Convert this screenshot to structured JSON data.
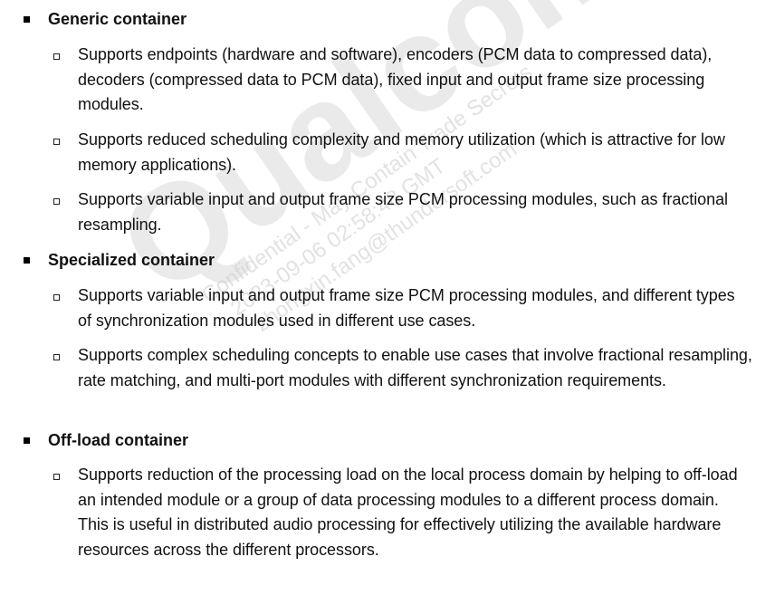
{
  "watermark": {
    "brand": "Qualcomm",
    "lines": [
      "Confidential - May Contain Trade Secrets",
      "2023-09-06 02:58:48 GMT",
      "zhongxin.fang@thundersoft.com"
    ]
  },
  "sections": [
    {
      "heading": "Generic container",
      "items": [
        "Supports endpoints (hardware and software), encoders (PCM data to compressed data), decoders (compressed data to PCM data), fixed input and output frame size processing modules.",
        "Supports reduced scheduling complexity and memory utilization (which is attractive for low memory applications).",
        "Supports variable input and output frame size PCM processing modules, such as fractional resampling."
      ]
    },
    {
      "heading": "Specialized container",
      "items": [
        "Supports variable input and output frame size PCM processing modules, and different types of synchronization modules used in different use cases.",
        "Supports complex scheduling concepts to enable use cases that involve fractional resampling, rate matching, and multi-port modules with different synchronization requirements."
      ]
    },
    {
      "heading": "Off-load container",
      "items": [
        "Supports reduction of the processing load on the local process domain by helping to off-load an intended module or a group of data processing modules to a different process domain. This is useful in distributed audio processing for effectively utilizing the available hardware resources across the different processors."
      ]
    }
  ]
}
